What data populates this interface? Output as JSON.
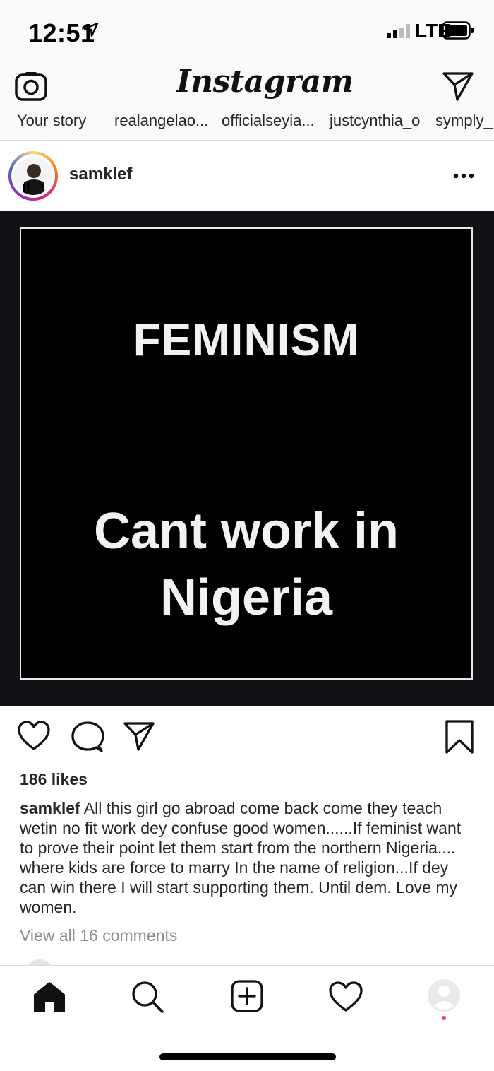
{
  "status_bar": {
    "time": "12:51",
    "carrier": "LTE",
    "icons": [
      "location-arrow-icon",
      "signal-icon",
      "battery-icon"
    ]
  },
  "nav": {
    "logo": "Instagram",
    "icons": [
      "camera-icon",
      "direct-message-icon"
    ]
  },
  "stories": [
    "Your story",
    "realangelao...",
    "officialseyia...",
    "justcynthia_o",
    "symply_"
  ],
  "post": {
    "username": "samklef",
    "image_headline": "FEMINISM",
    "image_body_line1": "Cant work in",
    "image_body_line2": "Nigeria",
    "likes": "186 likes",
    "caption": "All this girl go abroad come back come they teach wetin no fit work dey confuse good women......If feminist want to prove their point let them start from the northern Nigeria.... where kids are force to marry In the name of religion...If dey can win there I will start supporting them. Until dem. Love my women.",
    "view_comments": "View all 16 comments",
    "icons": [
      "heart-icon",
      "comment-icon",
      "share-icon",
      "bookmark-icon",
      "more-icon"
    ]
  },
  "tab_bar": {
    "items": [
      "home-icon",
      "search-icon",
      "add-post-icon",
      "activity-heart-icon",
      "profile-icon"
    ],
    "active": "home"
  },
  "colors": {
    "accent_red": "#ed4956",
    "text": "#262626",
    "muted": "#8e8e8e",
    "post_background": "#000000"
  }
}
